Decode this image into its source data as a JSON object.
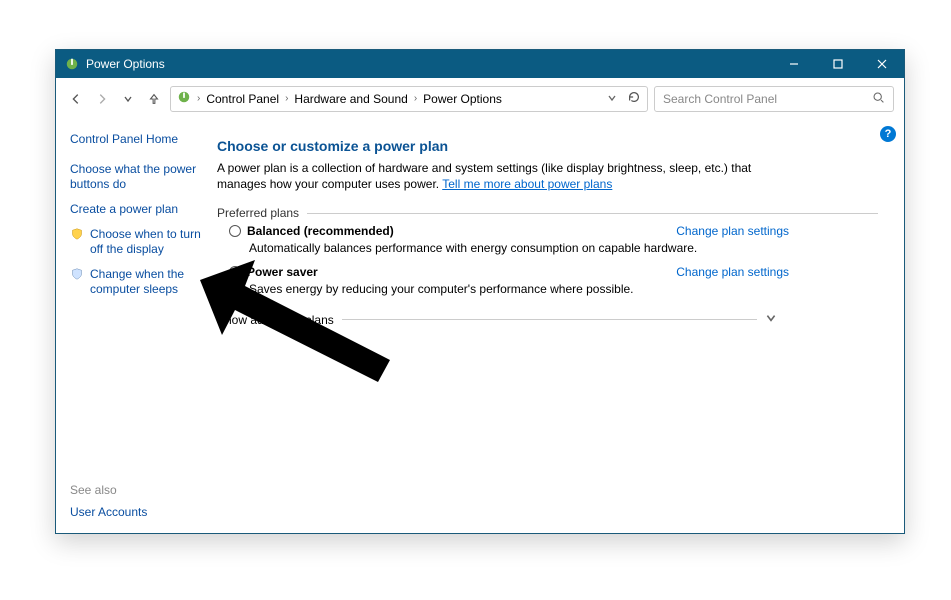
{
  "window": {
    "title": "Power Options"
  },
  "breadcrumbs": {
    "seg1": "Control Panel",
    "seg2": "Hardware and Sound",
    "seg3": "Power Options"
  },
  "search": {
    "placeholder": "Search Control Panel"
  },
  "sidebar": {
    "home": "Control Panel Home",
    "link1": "Choose what the power buttons do",
    "link2": "Create a power plan",
    "link3": "Choose when to turn off the display",
    "link4": "Change when the computer sleeps"
  },
  "seealso": {
    "label": "See also",
    "item1": "User Accounts"
  },
  "main": {
    "title": "Choose or customize a power plan",
    "desc_pre": "A power plan is a collection of hardware and system settings (like display brightness, sleep, etc.) that manages how your computer uses power. ",
    "desc_link": "Tell me more about power plans",
    "preferred_label": "Preferred plans",
    "plan1": {
      "name": "Balanced (recommended)",
      "desc": "Automatically balances performance with energy consumption on capable hardware.",
      "change": "Change plan settings"
    },
    "plan2": {
      "name": "Power saver",
      "desc": "Saves energy by reducing your computer's performance where possible.",
      "change": "Change plan settings"
    },
    "show_more": "Show additional plans"
  }
}
